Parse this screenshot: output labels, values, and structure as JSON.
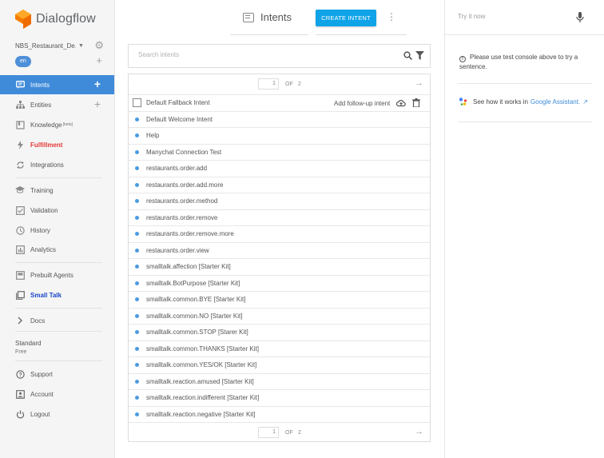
{
  "brand": {
    "name": "Dialogflow"
  },
  "agent": {
    "name": "NBS_Restaurant_De...",
    "language": "en"
  },
  "sidebar": {
    "items": [
      {
        "label": "Intents",
        "icon": "chat-icon"
      },
      {
        "label": "Entities",
        "icon": "hierarchy-icon"
      },
      {
        "label": "Knowledge",
        "badge": "[beta]",
        "icon": "book-icon"
      },
      {
        "label": "Fulfillment",
        "icon": "bolt-icon"
      },
      {
        "label": "Integrations",
        "icon": "sync-icon"
      },
      {
        "label": "Training",
        "icon": "graduation-icon"
      },
      {
        "label": "Validation",
        "icon": "checkbox-icon"
      },
      {
        "label": "History",
        "icon": "clock-icon"
      },
      {
        "label": "Analytics",
        "icon": "bar-chart-icon"
      },
      {
        "label": "Prebuilt Agents",
        "icon": "agent-icon"
      },
      {
        "label": "Small Talk",
        "icon": "copy-icon"
      },
      {
        "label": "Docs",
        "icon": "chevron-right-icon"
      },
      {
        "label": "Support",
        "icon": "help-icon"
      },
      {
        "label": "Account",
        "icon": "account-icon"
      },
      {
        "label": "Logout",
        "icon": "power-icon"
      }
    ],
    "plan": {
      "name": "Standard",
      "tier": "Free"
    }
  },
  "header": {
    "title": "Intents",
    "create_label": "CREATE INTENT"
  },
  "search": {
    "placeholder": "Search intents"
  },
  "pagination": {
    "current": "1",
    "of_label": "OF",
    "total": "2"
  },
  "intents": {
    "fallback": "Default Fallback Intent",
    "followup_label": "Add follow-up intent",
    "items": [
      "Default Welcome Intent",
      "Help",
      "Manychat Connection Test",
      "restaurants.order.add",
      "restaurants.order.add.more",
      "restaurants.order.method",
      "restaurants.order.remove",
      "restaurants.order.remove.more",
      "restaurants.order.view",
      "smalltalk.affection [Starter Kit]",
      "smalltalk.BotPurpose [Starter Kit]",
      "smalltalk.common.BYE [Starter Kit]",
      "smalltalk.common.NO [Starter Kit]",
      "smalltalk.common.STOP [Starer Kit]",
      "smalltalk.common.THANKS [Starter Kit]",
      "smalltalk.common.YES/OK [Starter Kit]",
      "smalltalk.reaction.amused [Starter Kit]",
      "smalltalk.reaction.indifferent [Starter Kit]",
      "smalltalk.reaction.negative [Starter Kit]"
    ]
  },
  "console": {
    "placeholder": "Try it now",
    "info": "Please use test console above to try a sentence.",
    "ga_text": "See how it works in",
    "ga_link": "Google Assistant."
  },
  "colors": {
    "accent": "#3f8bd9",
    "button": "#0fa3e8",
    "fulfillment": "#e53935",
    "smalltalk": "#1a46c8"
  }
}
